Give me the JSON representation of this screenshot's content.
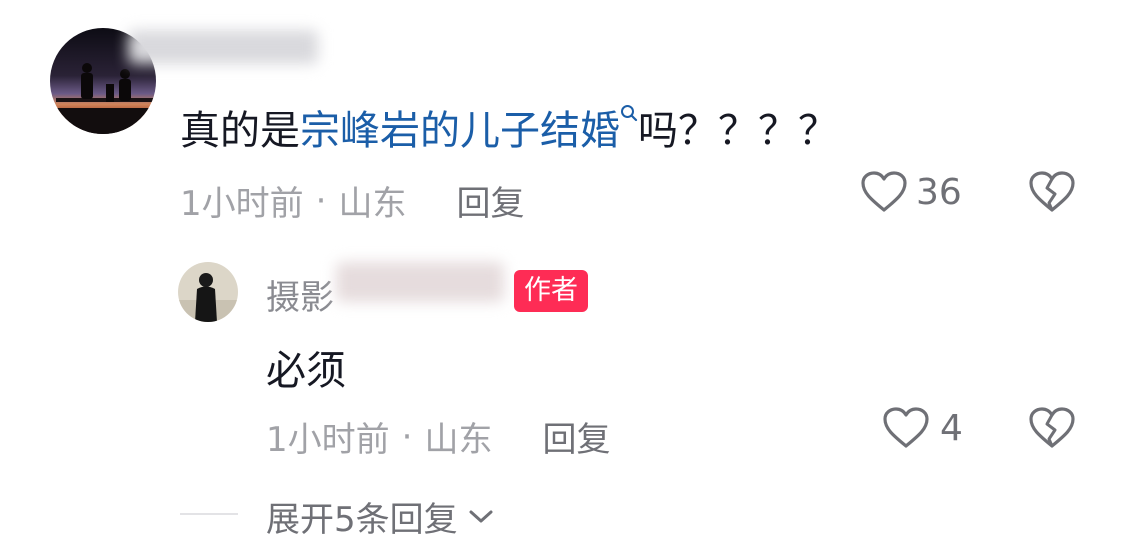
{
  "comment": {
    "text_before": "真的是",
    "link_text": "宗峰岩的儿子结婚",
    "text_after": "吗？？？？",
    "time": "1小时前",
    "separator": "·",
    "location": "山东",
    "reply_label": "回复",
    "like_count": "36"
  },
  "reply": {
    "username_visible": "摄影",
    "author_badge": "作者",
    "text": "必须",
    "time": "1小时前",
    "separator": "·",
    "location": "山东",
    "reply_label": "回复",
    "like_count": "4"
  },
  "expand": {
    "label": "展开5条回复"
  },
  "colors": {
    "link": "#1b5ea8",
    "badge": "#fe2c55",
    "meta": "#a1a2a7"
  },
  "icons": [
    "heart-icon",
    "broken-heart-icon",
    "search-icon",
    "chevron-down-icon"
  ]
}
